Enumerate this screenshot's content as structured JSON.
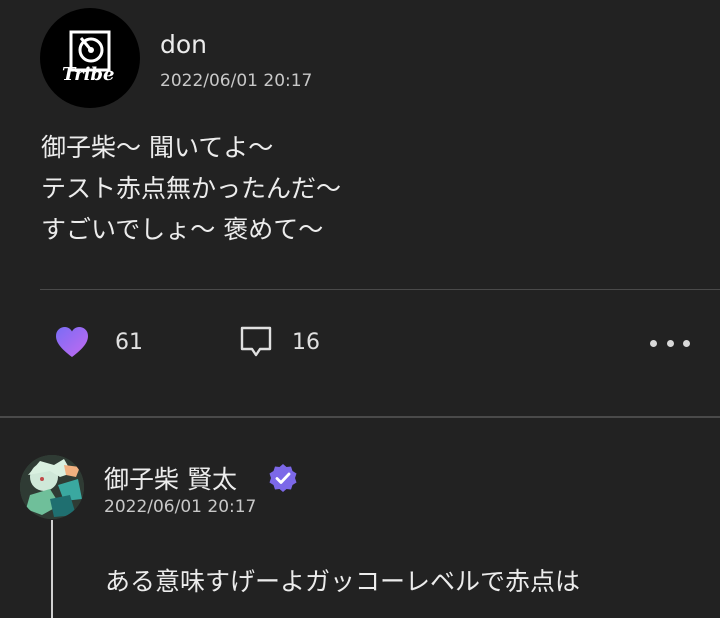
{
  "post": {
    "author": "don",
    "timestamp": "2022/06/01 20:17",
    "avatar_logo_text": "Tribe",
    "lines": [
      "御子柴〜 聞いてよ〜",
      "テスト赤点無かったんだ〜",
      "すごいでしょ〜 褒めて〜"
    ],
    "like_count": "61",
    "comment_count": "16",
    "icons": {
      "like": "heart-icon",
      "comment": "comment-icon",
      "more": "more-icon"
    }
  },
  "reply": {
    "author": "御子柴 賢太",
    "timestamp": "2022/06/01 20:17",
    "text": "ある意味すげーよガッコーレベルで赤点は",
    "verified_icon": "verified-badge-icon"
  },
  "colors": {
    "background": "#222222",
    "divider": "#4a4a4a",
    "heart_gradient": [
      "#7a6cf5",
      "#c36af0"
    ],
    "verified": "#7c68e8"
  }
}
